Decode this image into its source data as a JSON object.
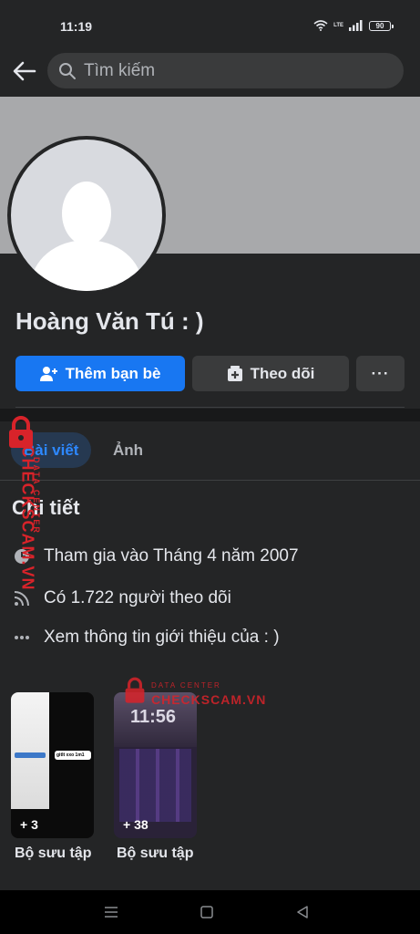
{
  "status_bar": {
    "time": "11:19",
    "network": "LTE",
    "battery": "90"
  },
  "nav": {
    "search_placeholder": "Tìm kiếm"
  },
  "profile": {
    "name": "Hoàng Văn Tú : )",
    "add_friend_label": "Thêm bạn bè",
    "follow_label": "Theo dõi",
    "more_label": "···"
  },
  "tabs": [
    {
      "label": "Bài viết",
      "active": true
    },
    {
      "label": "Ảnh",
      "active": false
    }
  ],
  "details": {
    "title": "Chi tiết",
    "joined": "Tham gia vào Tháng 4 năm 2007",
    "followers": "Có 1.722 người theo dõi",
    "about": "Xem thông tin giới thiệu của : )"
  },
  "collections": [
    {
      "count": "+ 3",
      "label": "Bộ sưu tập",
      "preview_text": "gitlt xxo 1m1"
    },
    {
      "count": "+ 38",
      "label": "Bộ sưu tập",
      "preview_text": "11:56"
    }
  ],
  "watermark": {
    "brand": "CHECKSCAM.VN",
    "tagline": "DATA CENTER"
  },
  "colors": {
    "accent": "#1877f2",
    "background": "#18191a",
    "surface": "#242526",
    "watermark": "#d8232a"
  },
  "icons": [
    "back-arrow-icon",
    "search-icon",
    "add-friend-icon",
    "follow-icon",
    "more-icon",
    "clock-icon",
    "rss-icon",
    "dots-icon",
    "lock-icon"
  ]
}
